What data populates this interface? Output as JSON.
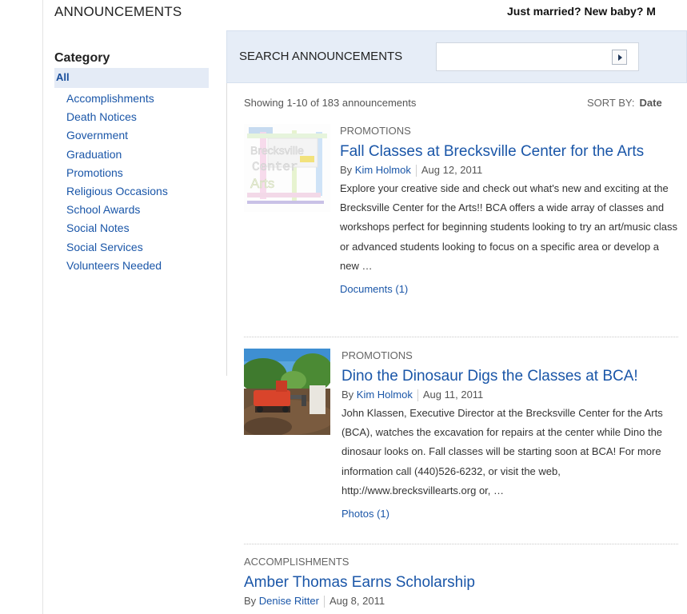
{
  "header": {
    "title": "ANNOUNCEMENTS",
    "promo": "Just married? New baby? M"
  },
  "sidebar": {
    "heading": "Category",
    "selected": "All",
    "items": [
      {
        "label": "Accomplishments"
      },
      {
        "label": "Death Notices"
      },
      {
        "label": "Government"
      },
      {
        "label": "Graduation"
      },
      {
        "label": "Promotions"
      },
      {
        "label": "Religious Occasions"
      },
      {
        "label": "School Awards"
      },
      {
        "label": "Social Notes"
      },
      {
        "label": "Social Services"
      },
      {
        "label": "Volunteers Needed"
      }
    ]
  },
  "search": {
    "label": "SEARCH ANNOUNCEMENTS",
    "value": "",
    "button_icon": "play-arrow-icon"
  },
  "results": {
    "showing": "Showing 1-10 of 183 announcements",
    "sort_label": "SORT BY:",
    "sort_value": "Date"
  },
  "announcements": [
    {
      "category": "PROMOTIONS",
      "title": "Fall Classes at Brecksville Center for the Arts",
      "by": "By",
      "author": "Kim Holmok",
      "date": "Aug 12, 2011",
      "excerpt": " Explore your creative side and check out what's new and exciting at the Brecksville Center for the Arts!! BCA offers a wide array of classes and workshops perfect for beginning students looking to try an art/music class or advanced students looking to focus on a specific area or develop a new …",
      "attachment": "Documents (1)",
      "thumb_text": [
        "Brecksville",
        "Center",
        "Arts"
      ]
    },
    {
      "category": "PROMOTIONS",
      "title": "Dino the Dinosaur Digs the Classes at BCA!",
      "by": "By",
      "author": "Kim Holmok",
      "date": "Aug 11, 2011",
      "excerpt": "John Klassen, Executive Director at the Brecksville Center for the Arts (BCA), watches the excavation for repairs at the center while Dino the dinosaur looks on. Fall classes will be starting soon at BCA! For more information call (440)526-6232, or visit the web, http://www.brecksvillearts.org or, …",
      "attachment": "Photos (1)"
    },
    {
      "category": "ACCOMPLISHMENTS",
      "title": "Amber Thomas Earns Scholarship",
      "by": "By",
      "author": "Denise Ritter",
      "date": "Aug 8, 2011"
    }
  ],
  "colors": {
    "link": "#1a56a8",
    "search_bg": "#e6edf7",
    "selected_bg": "#e4ebf6"
  }
}
